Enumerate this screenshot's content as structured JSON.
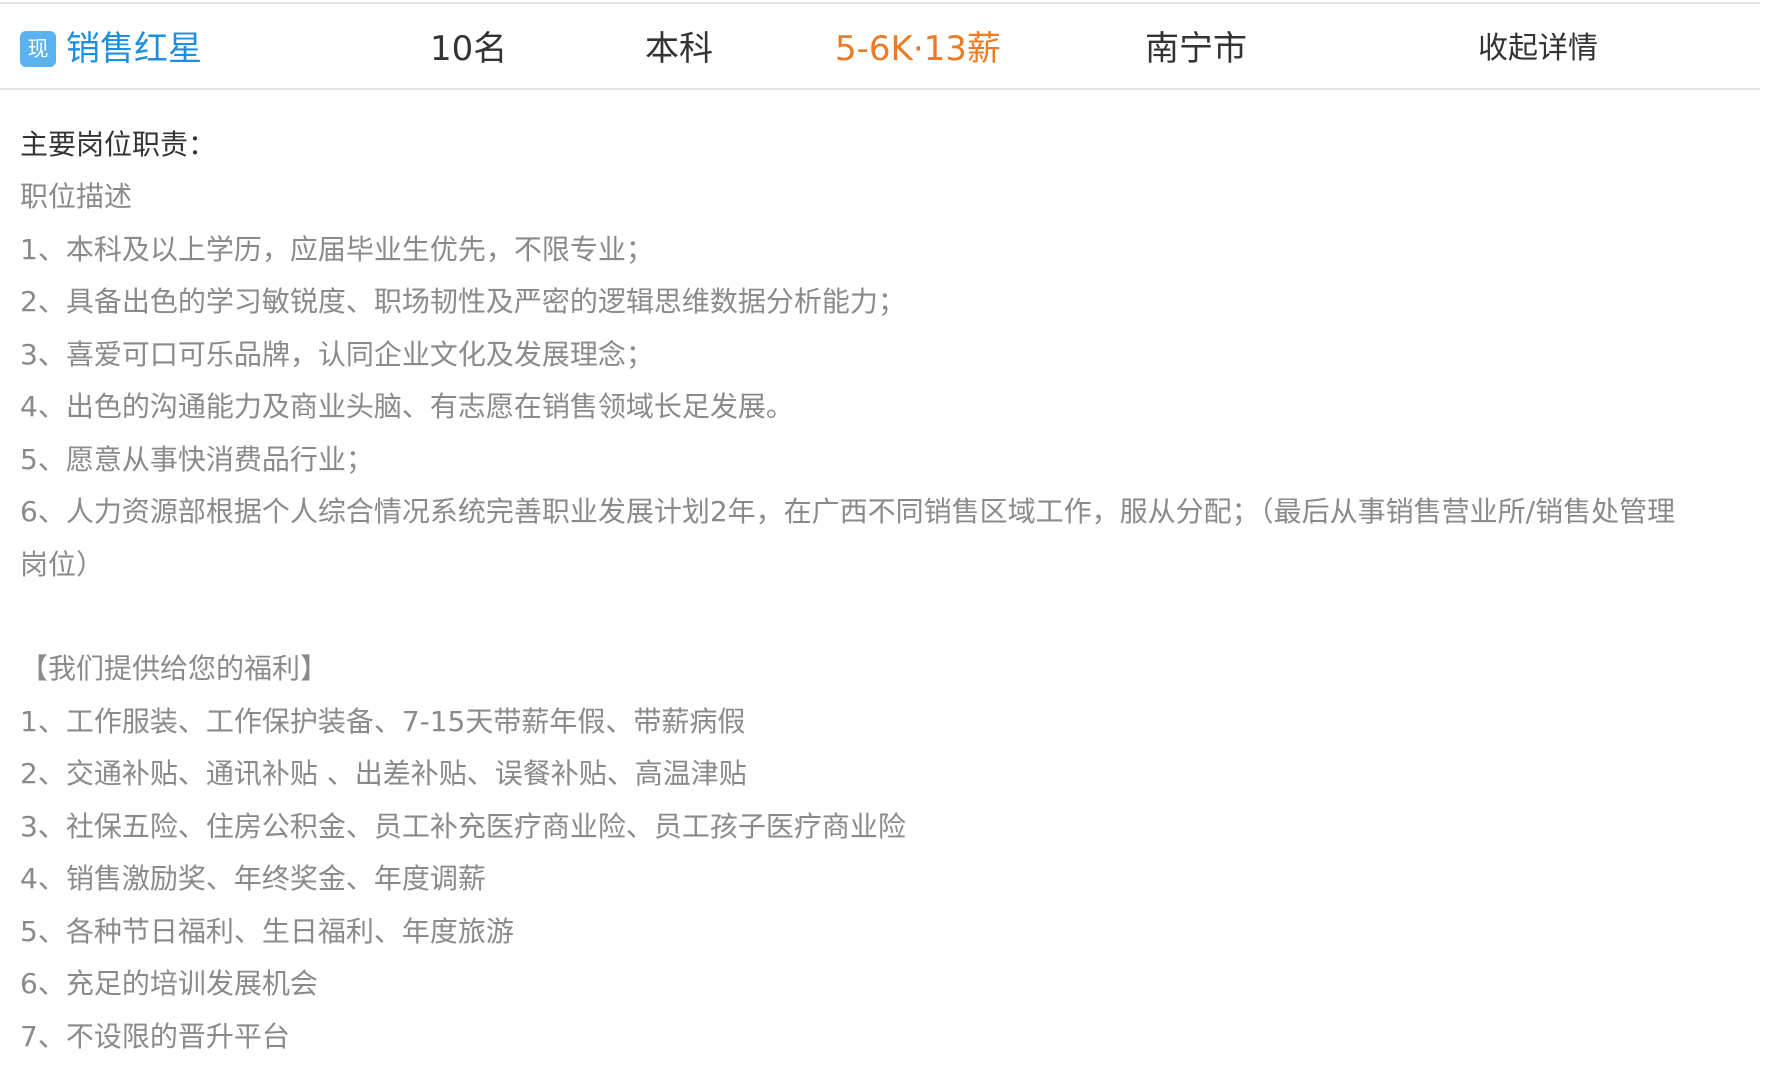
{
  "job": {
    "badge": "现",
    "title": "销售红星",
    "headcount": "10名",
    "education": "本科",
    "salary": "5-6K·13薪",
    "city": "南宁市",
    "toggle_label": "收起详情"
  },
  "details": {
    "heading": "主要岗位职责：",
    "description_title": "职位描述",
    "duties": [
      "1、本科及以上学历，应届毕业生优先，不限专业；",
      "2、具备出色的学习敏锐度、职场韧性及严密的逻辑思维数据分析能力；",
      "3、喜爱可口可乐品牌，认同企业文化及发展理念；",
      "4、出色的沟通能力及商业头脑、有志愿在销售领域长足发展。",
      "5、愿意从事快消费品行业；",
      "6、人力资源部根据个人综合情况系统完善职业发展计划2年，在广西不同销售区域工作，服从分配；（最后从事销售营业所/销售处管理",
      "岗位）"
    ],
    "benefits_title": "【我们提供给您的福利】",
    "benefits": [
      "1、工作服装、工作保护装备、7-15天带薪年假、带薪病假",
      "2、交通补贴、通讯补贴 、出差补贴、误餐补贴、高温津贴",
      "3、社保五险、住房公积金、员工补充医疗商业险、员工孩子医疗商业险",
      "4、销售激励奖、年终奖金、年度调薪",
      "5、各种节日福利、生日福利、年度旅游",
      "6、充足的培训发展机会",
      "7、不设限的晋升平台"
    ]
  },
  "colors": {
    "title": "#1e8fe0",
    "badge": "#5ab3f0",
    "salary": "#ee7a22",
    "body_text": "#8a8a8a",
    "strong_text": "#333333",
    "divider": "#e4e4e4"
  }
}
